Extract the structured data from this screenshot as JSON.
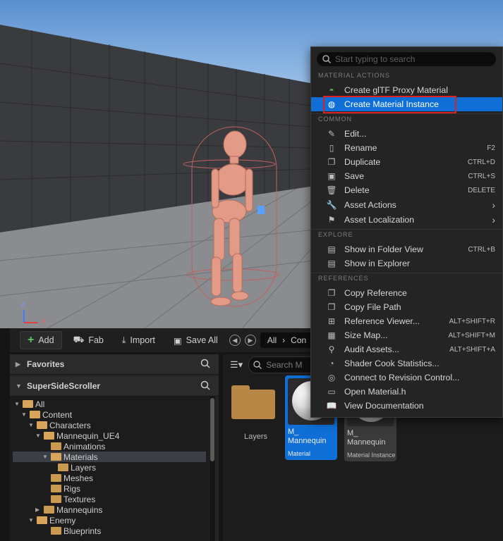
{
  "viewport": {
    "axis_z": "Z",
    "axis_x": "X"
  },
  "toolbar": {
    "add_label": "Add",
    "fab_label": "Fab",
    "import_label": "Import",
    "save_all_label": "Save All",
    "breadcrumb_root": "All",
    "breadcrumb_next": "Con"
  },
  "left_panel": {
    "favorites": "Favorites",
    "project": "SuperSideScroller",
    "tree": [
      {
        "label": "All"
      },
      {
        "label": "Content"
      },
      {
        "label": "Characters"
      },
      {
        "label": "Mannequin_UE4"
      },
      {
        "label": "Animations"
      },
      {
        "label": "Materials"
      },
      {
        "label": "Layers"
      },
      {
        "label": "Meshes"
      },
      {
        "label": "Rigs"
      },
      {
        "label": "Textures"
      },
      {
        "label": "Mannequins"
      },
      {
        "label": "Enemy"
      },
      {
        "label": "Blueprints"
      }
    ]
  },
  "right_panel": {
    "search_placeholder": "Search M",
    "folder_label": "Layers",
    "assets": [
      {
        "name1": "M_",
        "name2": "Mannequin",
        "type": "Material"
      },
      {
        "name1": "M_",
        "name2": "Mannequin",
        "type": "Material Instance"
      }
    ]
  },
  "menu": {
    "search_placeholder": "Start typing to search",
    "sections": {
      "material_actions": "MATERIAL ACTIONS",
      "common": "COMMON",
      "explore": "EXPLORE",
      "references": "REFERENCES"
    },
    "material_actions": [
      {
        "label": "Create glTF Proxy Material",
        "icon": "gltf-icon"
      },
      {
        "label": "Create Material Instance",
        "icon": "material-instance-icon"
      }
    ],
    "common": [
      {
        "label": "Edit...",
        "shortcut": ""
      },
      {
        "label": "Rename",
        "shortcut": "F2"
      },
      {
        "label": "Duplicate",
        "shortcut": "CTRL+D"
      },
      {
        "label": "Save",
        "shortcut": "CTRL+S"
      },
      {
        "label": "Delete",
        "shortcut": "DELETE"
      },
      {
        "label": "Asset Actions",
        "shortcut": ""
      },
      {
        "label": "Asset Localization",
        "shortcut": ""
      }
    ],
    "explore": [
      {
        "label": "Show in Folder View",
        "shortcut": "CTRL+B"
      },
      {
        "label": "Show in Explorer",
        "shortcut": ""
      }
    ],
    "references": [
      {
        "label": "Copy Reference",
        "shortcut": ""
      },
      {
        "label": "Copy File Path",
        "shortcut": ""
      },
      {
        "label": "Reference Viewer...",
        "shortcut": "ALT+SHIFT+R"
      },
      {
        "label": "Size Map...",
        "shortcut": "ALT+SHIFT+M"
      },
      {
        "label": "Audit Assets...",
        "shortcut": "ALT+SHIFT+A"
      },
      {
        "label": "Shader Cook Statistics...",
        "shortcut": ""
      },
      {
        "label": "Connect to Revision Control...",
        "shortcut": ""
      },
      {
        "label": "Open Material.h",
        "shortcut": ""
      },
      {
        "label": "View Documentation",
        "shortcut": ""
      }
    ]
  },
  "colors": {
    "highlight": "#0f6fd6",
    "annotation_box": "#e02020",
    "folder": "#c99a4f"
  }
}
